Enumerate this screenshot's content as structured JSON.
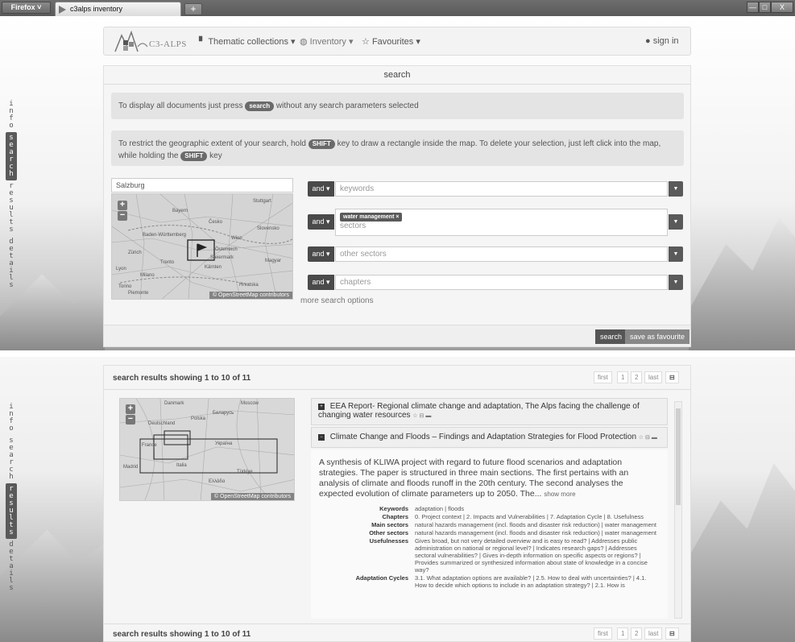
{
  "browser": {
    "menu_label": "Firefox ˅",
    "tab_title": "c3alps inventory",
    "new_tab": "+",
    "minimize": "—",
    "maximize": "□",
    "close": "X"
  },
  "side_tabs": [
    "info",
    "search",
    "results",
    "details"
  ],
  "nav": {
    "logo_text": "C3-ALPS",
    "thematic": "Thematic collections ▾",
    "inventory": "Inventory ▾",
    "favourites": "Favourites ▾",
    "signin": "sign in"
  },
  "search": {
    "heading": "search",
    "info1_pre": "To display all documents just press",
    "info1_kbd": "search",
    "info1_post": "without any search parameters selected",
    "info2_pre": "To restrict the geographic extent of your search, hold",
    "info2_kbd": "SHIFT",
    "info2_mid": "key to draw a rectangle inside the map. To delete your selection, just left click into the map, while holding the",
    "info2_kbd2": "SHIFT",
    "info2_post": "key",
    "location_value": "Salzburg",
    "map_credit": "© OpenStreetMap contributors",
    "map_labels": [
      "Stuttgart",
      "Bayern",
      "Baden-Württemberg",
      "Wien",
      "Slovensko",
      "Österreich",
      "Steiermark",
      "Kärnten",
      "Hrvatska",
      "Trento",
      "Milano",
      "Torino",
      "Piemonte",
      "Zürich",
      "Lyon",
      "Česko",
      "Magyar"
    ],
    "and_label": "and ▾",
    "fields": {
      "keywords": "keywords",
      "sectors_tag": "water management ×",
      "sectors": "sectors",
      "other_sectors": "other sectors",
      "chapters": "chapters"
    },
    "more_options": "more search options",
    "btn_search": "search",
    "btn_save": "save as favourite"
  },
  "results": {
    "title": "search results showing 1 to 10 of 11",
    "pager": [
      "first",
      "1",
      "2",
      "last"
    ],
    "map_labels": [
      "Danmark",
      "Moscow",
      "Deutschland",
      "Polska",
      "Беларусь",
      "Україна",
      "France",
      "Madrid",
      "Türkiye",
      "Italia",
      "Ελλάδα"
    ],
    "map_credit": "© OpenStreetMap contributors",
    "item1": "EEA Report- Regional climate change and adaptation, The Alps facing the challenge of changing water resources",
    "item2": "Climate Change and Floods – Findings and Adaptation Strategies for Flood Protection",
    "abstract": "A synthesis of KLIWA project with regard to future flood scenarios and adaptation strategies. The paper is structured in three main sections. The first pertains with an analysis of climate and floods runoff in the 20th century. The second analyses the expected evolution of climate parameters up to 2050. The...",
    "show_more": "show more",
    "details": [
      {
        "k": "Keywords",
        "v": "adaptation | floods"
      },
      {
        "k": "Chapters",
        "v": "0. Project context | 2. Impacts and Vulnerabilities | 7. Adaptation Cycle | 8. Usefulness"
      },
      {
        "k": "Main sectors",
        "v": "natural hazards management (incl. floods and disaster risk reduction) | water management"
      },
      {
        "k": "Other sectors",
        "v": "natural hazards management (incl. floods and disaster risk reduction) | water management"
      },
      {
        "k": "Usefulnesses",
        "v": "Gives broad, but not very detailed overview and is easy to read? | Addresses public administration on national or regional level? | Indicates research gaps? | Addresses sectoral vulnerabilities? | Gives in-depth information on specific aspects or regions? | Provides summarized or synthesized information about state of knowledge in a concise way?"
      },
      {
        "k": "Adaptation Cycles",
        "v": "3.1. What adaptation options are available? | 2.5. How to deal with uncertainties? | 4.1. How to decide which options to include in an adaptation strategy? | 2.1. How is"
      }
    ],
    "footer_title": "search results showing 1 to 10 of 11"
  }
}
